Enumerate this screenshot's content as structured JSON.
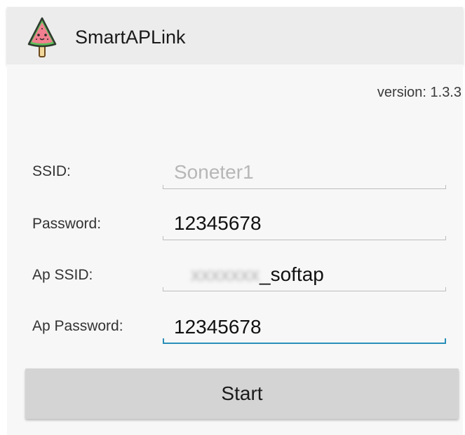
{
  "app": {
    "title": "SmartAPLink",
    "icon": "watermelon-popsicle-icon"
  },
  "version_text": "version: 1.3.3",
  "form": {
    "ssid": {
      "label": "SSID:",
      "placeholder": "Soneter1"
    },
    "password": {
      "label": "Password:",
      "value": "12345678"
    },
    "ap_ssid": {
      "label": "Ap SSID:",
      "value_suffix": "_softap"
    },
    "ap_password": {
      "label": "Ap Password:",
      "value": "12345678"
    }
  },
  "start_button": {
    "label": "Start"
  },
  "colors": {
    "app_bar": "#ececec",
    "focus_accent": "#2a8fb8",
    "button": "#d4d4d4"
  }
}
